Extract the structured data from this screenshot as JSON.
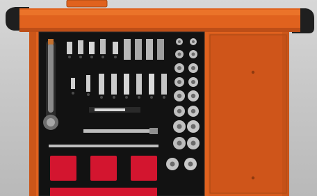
{
  "photo": {
    "subject": "tool-cabinet-drawer",
    "accent_colors": {
      "cabinet_orange": "#e0621e",
      "cabinet_orange_dark": "#b94d16",
      "foam_black": "#121212",
      "foam_red": "#d3152f",
      "handle_black": "#1c1c1c",
      "background_grey": "#c9c9c9"
    },
    "icons": [
      "ratchet-icon",
      "socket-icon",
      "bit-icon",
      "extension-bar-icon",
      "screwdriver-icon"
    ]
  }
}
